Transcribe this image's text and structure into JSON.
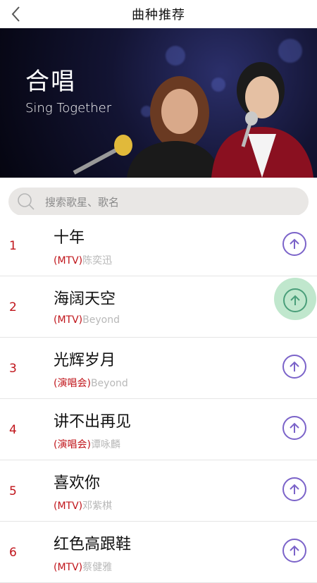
{
  "header": {
    "title": "曲种推荐"
  },
  "banner": {
    "title_cn": "合唱",
    "title_en": "Sing Together"
  },
  "search": {
    "placeholder": "搜索歌星、歌名"
  },
  "songs": [
    {
      "rank": "1",
      "title": "十年",
      "tag": "(MTV)",
      "artist": "陈奕迅"
    },
    {
      "rank": "2",
      "title": "海阔天空",
      "tag": "(MTV)",
      "artist": "Beyond"
    },
    {
      "rank": "3",
      "title": "光辉岁月",
      "tag": "(演唱会)",
      "artist": "Beyond"
    },
    {
      "rank": "4",
      "title": "讲不出再见",
      "tag": "(演唱会)",
      "artist": "谭咏麟"
    },
    {
      "rank": "5",
      "title": "喜欢你",
      "tag": "(MTV)",
      "artist": "邓紫棋"
    },
    {
      "rank": "6",
      "title": "红色高跟鞋",
      "tag": "(MTV)",
      "artist": "蔡健雅"
    }
  ],
  "colors": {
    "rank": "#c0141a",
    "accent": "#7b63c9",
    "active_halo": "#b9e4c8"
  },
  "icons": {
    "back": "chevron-left-icon",
    "search": "search-icon",
    "row_action": "arrow-up-circle-icon"
  }
}
